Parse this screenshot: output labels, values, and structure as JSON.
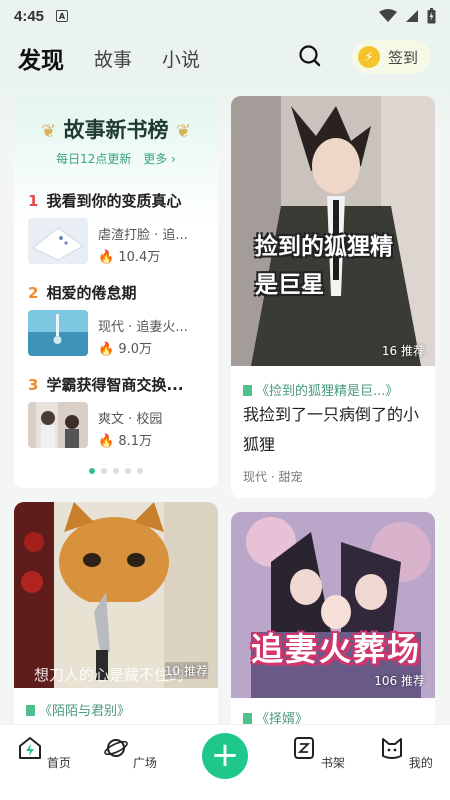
{
  "status": {
    "time": "4:45",
    "a_icon": "A"
  },
  "header": {
    "tabs": [
      {
        "label": "发现"
      },
      {
        "label": "故事"
      },
      {
        "label": "小说"
      }
    ],
    "signin_label": "签到"
  },
  "rank": {
    "title": "故事新书榜",
    "subtitle": "每日12点更新",
    "more": "更多 ›",
    "items": [
      {
        "num": "1",
        "title": "我看到你的变质真心",
        "tags": "虐渣打脸 · 追...",
        "hot": "10.4万"
      },
      {
        "num": "2",
        "title": "相爱的倦怠期",
        "tags": "现代 · 追妻火...",
        "hot": "9.0万"
      },
      {
        "num": "3",
        "title": "学霸获得智商交换...",
        "tags": "爽文 · 校园",
        "hot": "8.1万"
      }
    ]
  },
  "books": [
    {
      "cover_text": "捡到的狐狸精是巨星",
      "badge": "16 推荐",
      "series": "《捡到的狐狸精是巨...》",
      "title": "我捡到了一只病倒了的小狐狸",
      "tags": "现代 · 甜宠"
    },
    {
      "cover_text": "想刀人的心是藏不住的",
      "badge": "10 推荐",
      "series": "《陌陌与君别》"
    },
    {
      "cover_text": "追妻火葬场",
      "badge": "106 推荐",
      "series": "《择婿》"
    }
  ],
  "tabbar": [
    {
      "label": "首页"
    },
    {
      "label": "广场"
    },
    {
      "label": "+"
    },
    {
      "label": "书架"
    },
    {
      "label": "我的"
    }
  ]
}
